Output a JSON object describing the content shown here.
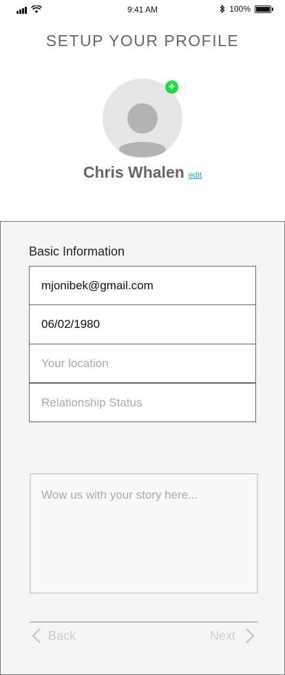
{
  "status_bar": {
    "time": "9:41 AM",
    "battery": "100%",
    "battery_level": 1.0
  },
  "header": {
    "title": "SETUP YOUR PROFILE"
  },
  "profile": {
    "name": "Chris Whalen",
    "edit_label": "edit",
    "add_photo_symbol": "+"
  },
  "form": {
    "section_label": "Basic Information",
    "email_value": "mjonibek@gmail.com",
    "dob_value": "06/02/1980",
    "location_placeholder": "Your location",
    "relationship_placeholder": "Relationship Status",
    "story_placeholder": "Wow us with your story here..."
  },
  "nav": {
    "back_label": "Back",
    "next_label": "Next"
  },
  "colors": {
    "accent_green": "#14e03a",
    "link_blue": "#1aa7d8"
  },
  "icons": [
    "signal-icon",
    "wifi-icon",
    "bluetooth-icon",
    "battery-icon",
    "avatar-placeholder-icon",
    "add-photo-icon",
    "chevron-left-icon",
    "chevron-right-icon"
  ]
}
